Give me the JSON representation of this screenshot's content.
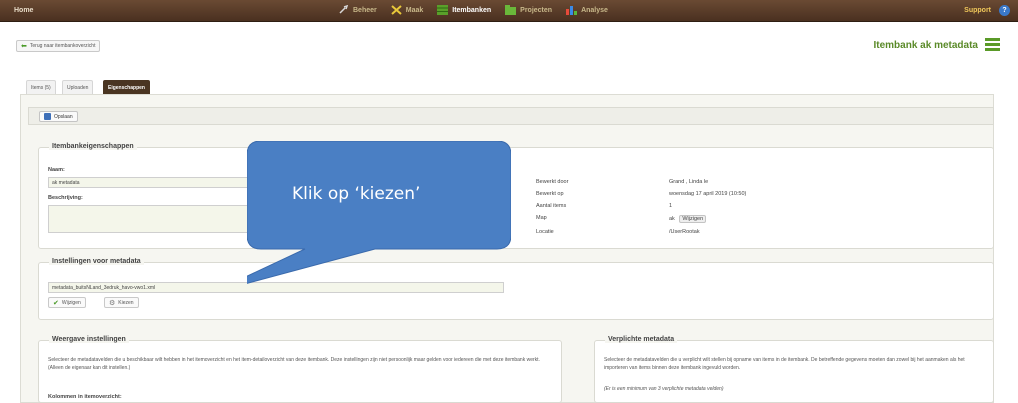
{
  "topbar": {
    "home": "Home",
    "nav": [
      {
        "label": "Beheer",
        "icon": "wrench-icon"
      },
      {
        "label": "Maak",
        "icon": "tools-icon"
      },
      {
        "label": "Itembanken",
        "icon": "grid-icon"
      },
      {
        "label": "Projecten",
        "icon": "folder-icon"
      },
      {
        "label": "Analyse",
        "icon": "bar-chart-icon"
      }
    ],
    "support": "Support",
    "support_icon": "?"
  },
  "back_button": "Terug naar itembankoverzicht",
  "page_title": "Itembank ak metadata",
  "tabs": [
    {
      "label": "Items (5)"
    },
    {
      "label": "Uploaden"
    },
    {
      "label": "Eigenschappen"
    }
  ],
  "toolbar": {
    "save_label": "Opslaan"
  },
  "properties": {
    "legend": "Itembankeigenschappen",
    "name_label": "Naam:",
    "name_value": "ak metadata",
    "description_label": "Beschrijving:",
    "meta": [
      {
        "key": "Bewerkt door",
        "value": "Grand , Linda le"
      },
      {
        "key": "Bewerkt op",
        "value": "woensdag 17 april 2019 (10:50)"
      },
      {
        "key": "Aantal items",
        "value": "1"
      },
      {
        "key": "Map",
        "value": "ak",
        "button": "Wijzigen"
      },
      {
        "key": "Locatie",
        "value": "/UserRootak"
      }
    ]
  },
  "metadata_settings": {
    "legend": "Instellingen voor metadata",
    "file_value": "metadata_buitsNLand_3edruk_havo-vwo1.xml",
    "edit_label": "Wijzigen",
    "choose_label": "Kiezen"
  },
  "display_settings": {
    "legend": "Weergave instellingen",
    "text": "Selecteer de metadatavelden die u beschikbaar wilt hebben in het itemoverzicht en het item-detailoverzicht van deze itembank. Deze instellingen zijn niet persoonlijk maar gelden voor iedereen die met deze itembank werkt. (Alleen de eigenaar kan dit instellen.)",
    "columns_heading": "Kolommen in itemoverzicht:"
  },
  "required_metadata": {
    "legend": "Verplichte metadata",
    "text": "Selecteer de metadatavelden die u verplicht wilt stellen bij opname van items in de itembank. De betreffende gegevens moeten dan zowel bij het aanmaken als het importeren van items binnen deze itembank ingevuld worden.",
    "note": "(Er is een minimum van 3 verplichte metadata velden)"
  },
  "callout": {
    "text": "Klik op ‘kiezen’",
    "color": "#4a7fc4"
  },
  "colors": {
    "topbar": "#5a3c28",
    "title_green": "#5a8a28",
    "active_tab": "#4a3522",
    "support": "#f0c85a"
  }
}
